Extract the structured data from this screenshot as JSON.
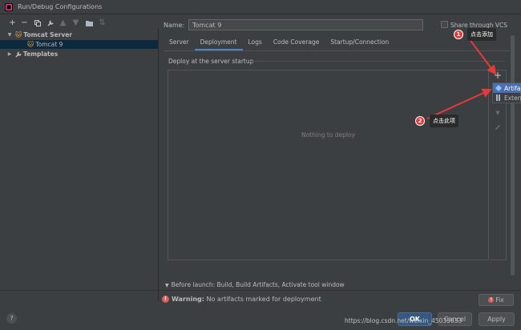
{
  "window": {
    "title": "Run/Debug Configurations"
  },
  "tree": {
    "group_label": "Tomcat Server",
    "item_label": "Tomcat 9",
    "templates_label": "Templates"
  },
  "form": {
    "name_label": "Name:",
    "name_value": "Tomcat 9",
    "share_label": "Share through VCS"
  },
  "tabs": [
    {
      "label": "Server"
    },
    {
      "label": "Deployment"
    },
    {
      "label": "Logs"
    },
    {
      "label": "Code Coverage"
    },
    {
      "label": "Startup/Connection"
    }
  ],
  "deployment": {
    "section_label": "Deploy at the server startup",
    "empty_text": "Nothing to deploy",
    "add_glyph": "+"
  },
  "popup": {
    "items": [
      {
        "label": "Artifact..."
      },
      {
        "label": "External Source..."
      }
    ]
  },
  "before_launch": "Before launch: Build, Build Artifacts, Activate tool window",
  "warning": {
    "label": "Warning:",
    "text": "No artifacts marked for deployment",
    "fix_label": "Fix"
  },
  "buttons": {
    "ok": "OK",
    "cancel": "Cancel",
    "apply": "Apply",
    "help": "?"
  },
  "annotations": {
    "badge1": "1",
    "note1": "点击添加",
    "badge2": "2",
    "note2": "点击此项",
    "watermark": "https://blog.csdn.net/weixin_45035633"
  },
  "colors": {
    "background": "#3c3f41",
    "accent_tab": "#4a88c7",
    "selection": "#4b6eaf",
    "annotation": "#e43a3a"
  }
}
